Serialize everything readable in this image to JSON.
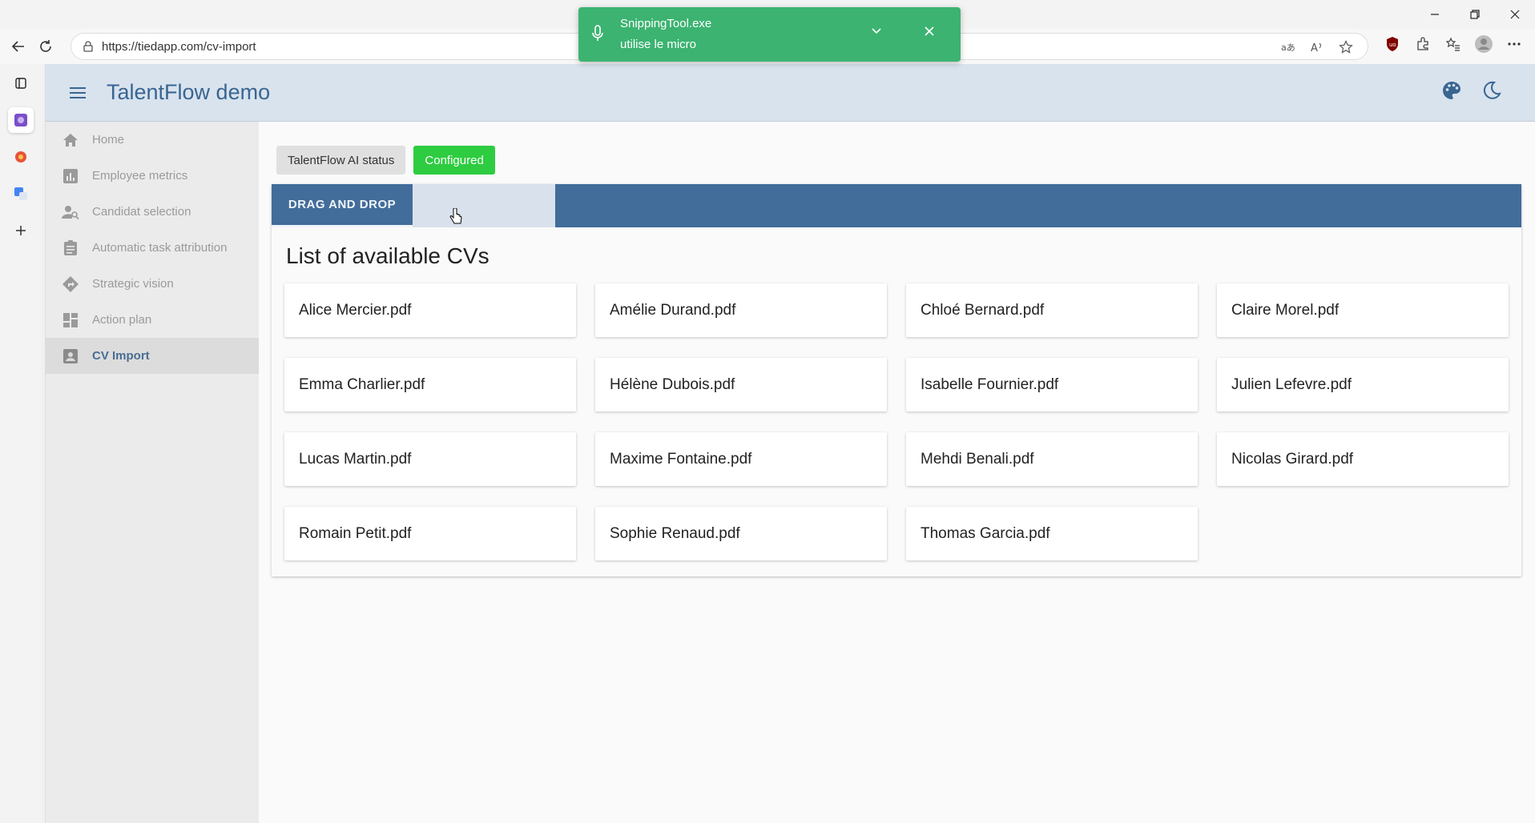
{
  "browser": {
    "url": "https://tiedapp.com/cv-import"
  },
  "toast": {
    "line1": "SnippingTool.exe",
    "line2": "utilise le micro"
  },
  "app": {
    "title": "TalentFlow demo"
  },
  "nav": {
    "items": [
      {
        "label": "Home",
        "icon": "home-icon"
      },
      {
        "label": "Employee metrics",
        "icon": "bar-chart-icon"
      },
      {
        "label": "Candidat selection",
        "icon": "person-search-icon"
      },
      {
        "label": "Automatic task attribution",
        "icon": "clipboard-icon"
      },
      {
        "label": "Strategic vision",
        "icon": "directions-icon"
      },
      {
        "label": "Action plan",
        "icon": "dashboard-icon"
      },
      {
        "label": "CV Import",
        "icon": "account-box-icon"
      }
    ],
    "active": "CV Import"
  },
  "status": {
    "label": "TalentFlow AI status",
    "value": "Configured",
    "value_color": "#2ecc40"
  },
  "tabs": {
    "drag_drop": "DRAG AND DROP"
  },
  "cv_list": {
    "title": "List of available CVs",
    "files": [
      "Alice Mercier.pdf",
      "Amélie Durand.pdf",
      "Chloé Bernard.pdf",
      "Claire Morel.pdf",
      "Emma Charlier.pdf",
      "Hélène Dubois.pdf",
      "Isabelle Fournier.pdf",
      "Julien Lefevre.pdf",
      "Lucas Martin.pdf",
      "Maxime Fontaine.pdf",
      "Mehdi Benali.pdf",
      "Nicolas Girard.pdf",
      "Romain Petit.pdf",
      "Sophie Renaud.pdf",
      "Thomas Garcia.pdf"
    ]
  },
  "colors": {
    "accent": "#426c9a",
    "header_bg": "#d8e3ee",
    "toast_bg": "#3cb371"
  }
}
